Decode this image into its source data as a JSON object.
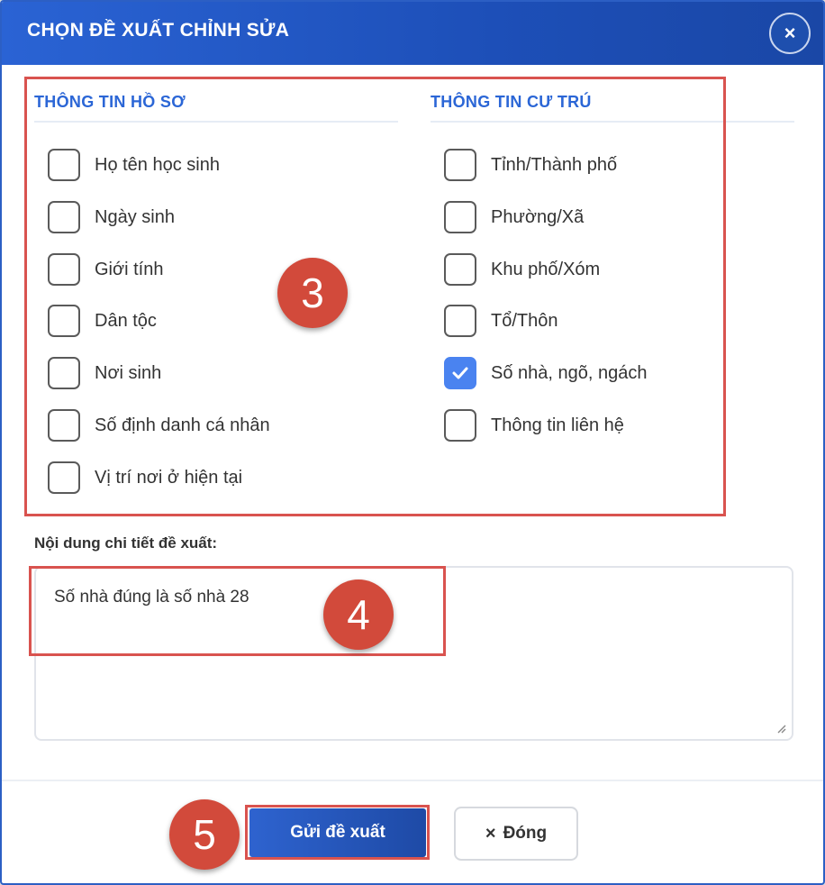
{
  "dialog": {
    "title": "CHỌN ĐỀ XUẤT CHỈNH SỬA",
    "close_symbol": "×"
  },
  "profile_section": {
    "title": "THÔNG TIN HỒ SƠ",
    "items": [
      {
        "label": "Họ tên học sinh",
        "checked": false
      },
      {
        "label": "Ngày sinh",
        "checked": false
      },
      {
        "label": "Giới tính",
        "checked": false
      },
      {
        "label": "Dân tộc",
        "checked": false
      },
      {
        "label": "Nơi sinh",
        "checked": false
      },
      {
        "label": "Số định danh cá nhân",
        "checked": false
      },
      {
        "label": "Vị trí nơi ở hiện tại",
        "checked": false
      }
    ]
  },
  "residence_section": {
    "title": "THÔNG TIN CƯ TRÚ",
    "items": [
      {
        "label": "Tỉnh/Thành phố",
        "checked": false
      },
      {
        "label": "Phường/Xã",
        "checked": false
      },
      {
        "label": "Khu phố/Xóm",
        "checked": false
      },
      {
        "label": "Tổ/Thôn",
        "checked": false
      },
      {
        "label": "Số nhà, ngõ, ngách",
        "checked": true
      },
      {
        "label": "Thông tin liên hệ",
        "checked": false
      }
    ]
  },
  "detail": {
    "label": "Nội dung chi tiết đề xuất:",
    "value": "Số nhà đúng là số nhà 28"
  },
  "footer": {
    "send_label": "Gửi đề xuất",
    "close_icon": "×",
    "close_label": "Đóng"
  },
  "markers": {
    "m3": "3",
    "m4": "4",
    "m5": "5"
  },
  "colors": {
    "header": "#1d4fb8",
    "accent": "#2b66d6",
    "checkbox_checked": "#4a83f0",
    "annotation": "#d24a3b"
  }
}
